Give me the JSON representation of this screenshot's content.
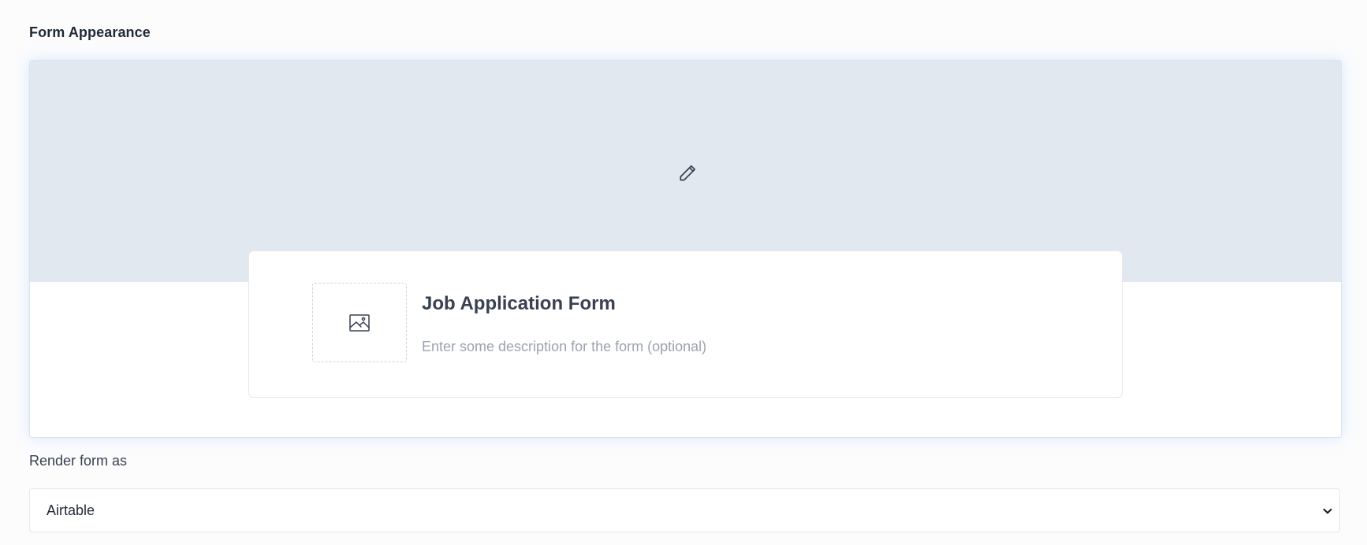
{
  "section": {
    "title": "Form Appearance"
  },
  "cover": {
    "edit_icon": "pencil-icon",
    "background_color": "#e2e8f0"
  },
  "form_header": {
    "logo_icon": "image-icon",
    "title": "Job Application Form",
    "description_placeholder": "Enter some description for the form (optional)"
  },
  "render": {
    "label": "Render form as",
    "selected_value": "Airtable",
    "chevron_icon": "chevron-down-icon"
  }
}
